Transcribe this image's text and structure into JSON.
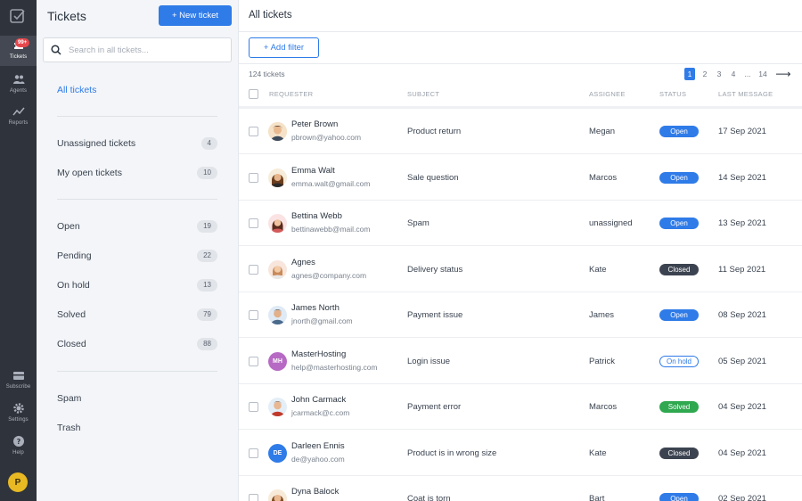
{
  "rail": {
    "items": [
      {
        "label": "Tickets",
        "badge": "99+"
      },
      {
        "label": "Agents"
      },
      {
        "label": "Reports"
      },
      {
        "label": "Subscribe"
      },
      {
        "label": "Settings"
      },
      {
        "label": "Help"
      }
    ],
    "avatar_letter": "P"
  },
  "sidebar": {
    "title": "Tickets",
    "new_ticket_label": "+ New ticket",
    "search_placeholder": "Search in all tickets...",
    "items": [
      {
        "label": "All tickets"
      },
      {
        "label": "Unassigned tickets",
        "count": "4"
      },
      {
        "label": "My open tickets",
        "count": "10"
      },
      {
        "label": "Open",
        "count": "19"
      },
      {
        "label": "Pending",
        "count": "22"
      },
      {
        "label": "On hold",
        "count": "13"
      },
      {
        "label": "Solved",
        "count": "79"
      },
      {
        "label": "Closed",
        "count": "88"
      },
      {
        "label": "Spam"
      },
      {
        "label": "Trash"
      }
    ]
  },
  "main": {
    "title": "All tickets",
    "add_filter_label": "+ Add filter",
    "total": "124 tickets",
    "pagination": [
      "1",
      "2",
      "3",
      "4",
      "...",
      "14",
      "⟶"
    ],
    "columns": [
      "REQUESTER",
      "SUBJECT",
      "ASSIGNEE",
      "STATUS",
      "LAST MESSAGE"
    ],
    "rows": [
      {
        "name": "Peter Brown",
        "email": "pbrown@yahoo.com",
        "subject": "Product return",
        "assignee": "Megan",
        "status": "Open",
        "date": "17 Sep 2021"
      },
      {
        "name": "Emma Walt",
        "email": "emma.walt@gmail.com",
        "subject": "Sale question",
        "assignee": "Marcos",
        "status": "Open",
        "date": "14 Sep 2021"
      },
      {
        "name": "Bettina Webb",
        "email": "bettinawebb@mail.com",
        "subject": "Spam",
        "assignee": "unassigned",
        "status": "Open",
        "date": "13 Sep 2021"
      },
      {
        "name": "Agnes",
        "email": "agnes@company.com",
        "subject": "Delivery status",
        "assignee": "Kate",
        "status": "Closed",
        "date": "11 Sep 2021"
      },
      {
        "name": "James North",
        "email": "jnorth@gmail.com",
        "subject": "Payment issue",
        "assignee": "James",
        "status": "Open",
        "date": "08 Sep 2021"
      },
      {
        "name": "MasterHosting",
        "email": "help@masterhosting.com",
        "subject": "Login issue",
        "assignee": "Patrick",
        "status": "On hold",
        "date": "05 Sep 2021",
        "initials": "MH"
      },
      {
        "name": "John Carmack",
        "email": "jcarmack@c.com",
        "subject": "Payment error",
        "assignee": "Marcos",
        "status": "Solved",
        "date": "04 Sep 2021"
      },
      {
        "name": "Darleen Ennis",
        "email": "de@yahoo.com",
        "subject": "Product is in wrong size",
        "assignee": "Kate",
        "status": "Closed",
        "date": "04 Sep 2021",
        "initials": "DE"
      },
      {
        "name": "Dyna Balock",
        "email": "",
        "subject": "Coat is torn",
        "assignee": "Bart",
        "status": "Open",
        "date": "02 Sep 2021"
      }
    ]
  },
  "colors": {
    "accent": "#2f7be8",
    "rail": "#2f333b",
    "closed": "#3c4350",
    "solved": "#2fa84f",
    "badge": "#e5484d"
  }
}
